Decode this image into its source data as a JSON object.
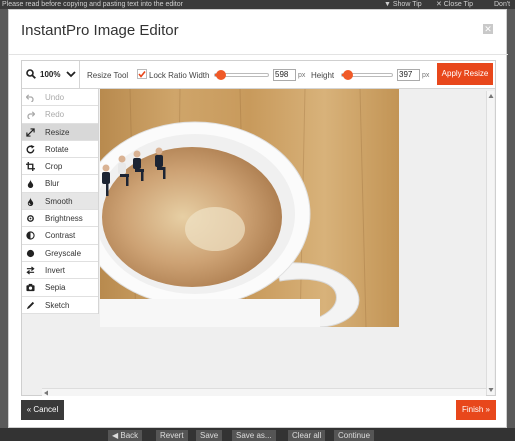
{
  "background": {
    "top_text": "Please read before copying and pasting text into the editor",
    "show_tip": "▼ Show Tip",
    "close_tip": "✕ Close Tip",
    "dont": "Don't",
    "bottom_buttons": [
      "◀ Back",
      "Revert",
      "Save",
      "Save as...",
      "Clear all",
      "Continue"
    ]
  },
  "dialog": {
    "title": "InstantPro Image Editor",
    "close_icon": "close-icon"
  },
  "toolbar": {
    "zoom_value": "100%",
    "tool_name": "Resize Tool",
    "lock_ratio_label": "Lock Ratio",
    "lock_ratio_checked": true,
    "width_label": "Width",
    "width_value": "598",
    "width_unit": "px",
    "width_level": 0.1,
    "height_label": "Height",
    "height_value": "397",
    "height_unit": "px",
    "height_level": 0.1,
    "apply_label": "Apply Resize"
  },
  "menu": {
    "items": [
      {
        "label": "Undo",
        "icon": "undo-icon",
        "state": "disabled"
      },
      {
        "label": "Redo",
        "icon": "redo-icon",
        "state": "disabled"
      },
      {
        "label": "Resize",
        "icon": "resize-icon",
        "state": "active"
      },
      {
        "label": "Rotate",
        "icon": "rotate-icon",
        "state": "normal"
      },
      {
        "label": "Crop",
        "icon": "crop-icon",
        "state": "normal"
      },
      {
        "label": "Blur",
        "icon": "blur-icon",
        "state": "normal"
      },
      {
        "label": "Smooth",
        "icon": "smooth-icon",
        "state": "highlight"
      },
      {
        "label": "Brightness",
        "icon": "brightness-icon",
        "state": "normal"
      },
      {
        "label": "Contrast",
        "icon": "contrast-icon",
        "state": "normal"
      },
      {
        "label": "Greyscale",
        "icon": "greyscale-icon",
        "state": "normal"
      },
      {
        "label": "Invert",
        "icon": "invert-icon",
        "state": "normal"
      },
      {
        "label": "Sepia",
        "icon": "sepia-icon",
        "state": "normal"
      },
      {
        "label": "Sketch",
        "icon": "sketch-icon",
        "state": "normal"
      }
    ]
  },
  "footer": {
    "cancel_label": "« Cancel",
    "finish_label": "Finish »"
  },
  "colors": {
    "accent": "#e8471b",
    "dark_button": "#3a3a3a"
  }
}
